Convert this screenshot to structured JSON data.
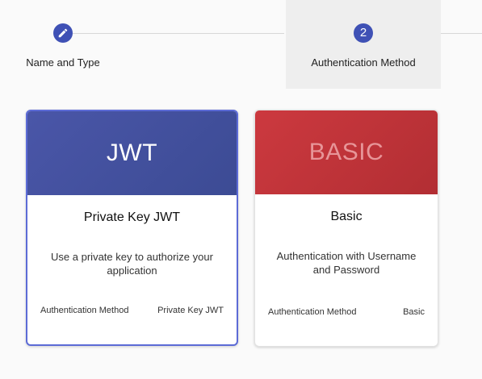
{
  "stepper": {
    "steps": [
      {
        "label": "Name and Type",
        "icon": "pencil-icon",
        "active": false
      },
      {
        "label": "Authentication Method",
        "number": "2",
        "active": true
      }
    ],
    "accent_color": "#3f51b5"
  },
  "cards": [
    {
      "header": "JWT",
      "title": "Private Key JWT",
      "description": "Use a private key to authorize your application",
      "meta_label": "Authentication Method",
      "meta_value": "Private Key JWT",
      "header_color": "#414f9e",
      "selected": true
    },
    {
      "header": "BASIC",
      "title": "Basic",
      "description": "Authentication with Username and Password",
      "meta_label": "Authentication Method",
      "meta_value": "Basic",
      "header_color": "#c0353a",
      "selected": false
    }
  ]
}
